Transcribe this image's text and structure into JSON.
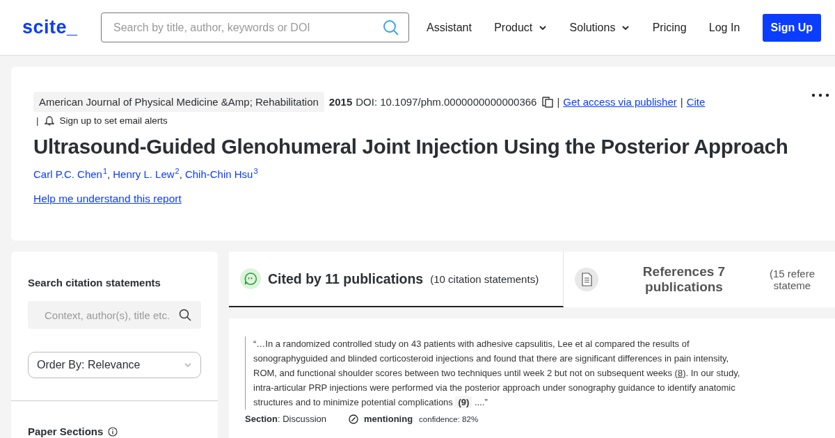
{
  "header": {
    "logo": "scite_",
    "search": {
      "placeholder": "Search by title, author, keywords or DOI"
    },
    "nav": [
      {
        "label": "Assistant",
        "kind": "link"
      },
      {
        "label": "Product",
        "kind": "dropdown"
      },
      {
        "label": "Solutions",
        "kind": "dropdown"
      },
      {
        "label": "Pricing",
        "kind": "link"
      },
      {
        "label": "Log In",
        "kind": "link"
      },
      {
        "label": "Sign Up",
        "kind": "button"
      }
    ]
  },
  "paper": {
    "journal": "American Journal of Physical Medicine &Amp; Rehabilitation",
    "year": "2015",
    "doi": "DOI: 10.1097/phm.0000000000000366",
    "links": [
      {
        "separator": "|",
        "label": "Get access via publisher"
      },
      {
        "separator": "|",
        "label": "Cite"
      }
    ],
    "alerts": {
      "separator": "|",
      "label": "Sign up to set email alerts"
    },
    "title": "Ultrasound-Guided Glenohumeral Joint Injection Using the Posterior Approach",
    "authors": [
      {
        "name": "Carl P.C. Chen",
        "affiliation": "1",
        "separator": ","
      },
      {
        "name": "Henry L. Lew",
        "affiliation": "2",
        "separator": ","
      },
      {
        "name": "Chih-Chin Hsu",
        "affiliation": "3"
      }
    ],
    "help_link": "Help me understand this report"
  },
  "sidebar": {
    "search_heading": "Search citation statements",
    "search": {
      "placeholder": "Context, author(s), title etc."
    },
    "order_by": "Order By: Relevance",
    "sections_heading": "Paper Sections"
  },
  "tabs": [
    {
      "kind": "cited",
      "title": "Cited by 11 publications",
      "count": "(10 citation statements)",
      "selected": true
    },
    {
      "kind": "references",
      "title": "References 7 publications",
      "count": "(15 refere\nstateme",
      "selected": false
    }
  ],
  "citations": [
    {
      "quote": [
        {
          "kind": "text",
          "text": "“…In a randomized controlled study on 43 patients with adhesive capsulitis, Lee et al compared the results of sonographyguided and blinded corticosteroid injections and found that there are significant differences in pain intensity, ROM, and functional shoulder scores between two techniques until week 2 but not on subsequent weeks "
        },
        {
          "kind": "ref",
          "text": "(8)"
        },
        {
          "kind": "text",
          "text": ". In our study, intra-articular PRP injections were performed via the posterior approach under sonography guidance to identify anatomic structures and to minimize potential complications "
        },
        {
          "kind": "badge",
          "text": "(9)"
        },
        {
          "kind": "text",
          "text": " ....”"
        }
      ],
      "section": "**Section**: Discussion",
      "type": "mentioning",
      "confidence": "confidence: 82%"
    }
  ]
}
